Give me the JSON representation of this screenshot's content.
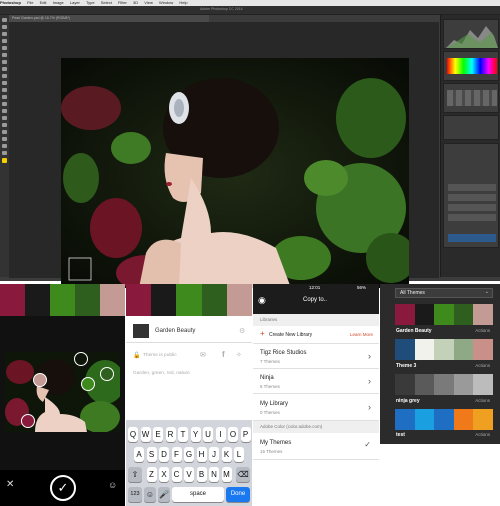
{
  "photoshop": {
    "menubar": [
      "Photoshop",
      "File",
      "Edit",
      "Image",
      "Layer",
      "Type",
      "Select",
      "Filter",
      "3D",
      "View",
      "Window",
      "Help"
    ],
    "window_title": "Adobe Photoshop CC 2014",
    "doc_tab": "Pearl Garden.psd @ 16.7% (RGB/8*)"
  },
  "capture": {
    "palette": [
      "#8a1a3d",
      "#1a1a1a",
      "#3f8a1c",
      "#2e5f1e",
      "#c49a95"
    ]
  },
  "theme_editor": {
    "palette": [
      "#8a1a3d",
      "#1a1a1a",
      "#3f8a1c",
      "#2e5f1e",
      "#c49a95"
    ],
    "theme_name": "Garden Beauty",
    "public_note": "Theme is public",
    "tags": "Garden, green, red, nature",
    "keyboard": {
      "row1": [
        "Q",
        "W",
        "E",
        "R",
        "T",
        "Y",
        "U",
        "I",
        "O",
        "P"
      ],
      "row2": [
        "A",
        "S",
        "D",
        "F",
        "G",
        "H",
        "J",
        "K",
        "L"
      ],
      "row3": [
        "Z",
        "X",
        "C",
        "V",
        "B",
        "N",
        "M"
      ],
      "numbers_key": "123",
      "space_key": "space",
      "done_key": "Done"
    }
  },
  "copy_to": {
    "time": "12:01",
    "battery": "56%",
    "title": "Copy to..",
    "libraries_header": "Libraries",
    "create_new": "Create New Library",
    "learn_more": "Learn More",
    "libraries": [
      {
        "name": "Tigz Rice Studios",
        "count": "7 Themes"
      },
      {
        "name": "Ninja",
        "count": "5 Themes"
      },
      {
        "name": "My Library",
        "count": "0 Themes"
      }
    ],
    "adobe_color_header": "Adobe Color (color.adobe.com)",
    "my_themes": {
      "name": "My Themes",
      "count": "15 Themes"
    }
  },
  "themes_panel": {
    "filter": "All Themes",
    "themes": [
      {
        "name": "Garden Beauty",
        "actions": "Actions",
        "colors": [
          "#8a1a3d",
          "#1a1a1a",
          "#3f8a1c",
          "#2e5f1e",
          "#c49a95"
        ]
      },
      {
        "name": "Theme 3",
        "actions": "Actions",
        "colors": [
          "#1f4d7a",
          "#f2f2ec",
          "#c2d1b8",
          "#8fa885",
          "#c9908a"
        ]
      },
      {
        "name": "ninja grey",
        "actions": "Actions",
        "colors": [
          "#3a3a3a",
          "#5a5a5a",
          "#7a7a7a",
          "#9a9a9a",
          "#bcbcbc"
        ]
      },
      {
        "name": "test",
        "actions": "Actions",
        "colors": [
          "#1e6fc4",
          "#1aa0e0",
          "#1e6fc4",
          "#f07a1a",
          "#f0a020"
        ]
      }
    ]
  }
}
